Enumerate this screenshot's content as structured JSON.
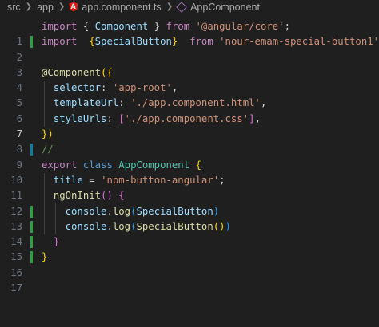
{
  "breadcrumb": {
    "items": [
      "src",
      "app",
      "app.component.ts",
      "AppComponent"
    ]
  },
  "colors": {
    "background": "#1f1f1f",
    "keyword": "#c586c0",
    "string": "#ce9178",
    "class": "#4ec9b0",
    "gutter_added": "#2ea043",
    "gutter_modified": "#0c7d9d"
  },
  "icons": {
    "file_icon": "angular-icon",
    "symbol_icon": "class-symbol-icon"
  },
  "editor": {
    "active_line": 7,
    "lines": [
      {
        "number": "1",
        "gutter": "none"
      },
      {
        "number": "2",
        "gutter": "added"
      },
      {
        "number": "3",
        "gutter": "none"
      },
      {
        "number": "4",
        "gutter": "none"
      },
      {
        "number": "5",
        "gutter": "none"
      },
      {
        "number": "6",
        "gutter": "none"
      },
      {
        "number": "7",
        "gutter": "none"
      },
      {
        "number": "8",
        "gutter": "none"
      },
      {
        "number": "9",
        "gutter": "modified"
      },
      {
        "number": "10",
        "gutter": "none"
      },
      {
        "number": "11",
        "gutter": "none"
      },
      {
        "number": "12",
        "gutter": "none"
      },
      {
        "number": "13",
        "gutter": "added"
      },
      {
        "number": "14",
        "gutter": "added"
      },
      {
        "number": "15",
        "gutter": "added"
      },
      {
        "number": "16",
        "gutter": "added"
      },
      {
        "number": "17",
        "gutter": "none"
      }
    ],
    "code": {
      "l1": {
        "import": "import",
        "ob": "{ ",
        "name": "Component",
        "cb": " }",
        "from": "from",
        "src": "'@angular/core'",
        "semi": ";"
      },
      "l2": {
        "import": "import",
        "ob": "{",
        "name": "SpecialButton",
        "cb": "}",
        "from": "from",
        "src": "'nour-emam-special-button1'",
        "semi": ";"
      },
      "l4": {
        "at": "@",
        "dec": "Component",
        "open": "({"
      },
      "l5": {
        "key": "selector",
        "colon": ": ",
        "val": "'app-root'",
        "comma": ","
      },
      "l6": {
        "key": "templateUrl",
        "colon": ": ",
        "val": "'./app.component.html'",
        "comma": ","
      },
      "l7": {
        "key": "styleUrls",
        "colon": ": ",
        "ob": "[",
        "val": "'./app.component.css'",
        "cb": "]",
        "comma": ","
      },
      "l8": {
        "close": "})"
      },
      "l9": {
        "comment": "//"
      },
      "l10": {
        "export": "export",
        "class": "class",
        "name": "AppComponent",
        "ob": "{"
      },
      "l11": {
        "key": "title",
        "eq": " = ",
        "val": "'npm-button-angular'",
        "semi": ";"
      },
      "l12": {
        "fn": "ngOnInit",
        "parens": "()",
        "ob": "{"
      },
      "l13": {
        "obj": "console",
        "dot": ".",
        "fn": "log",
        "op": "(",
        "arg": "SpecialButton",
        "cp": ")"
      },
      "l14": {
        "obj": "console",
        "dot": ".",
        "fn": "log",
        "op": "(",
        "arg": "SpecialButton",
        "call": "()",
        "cp": ")"
      },
      "l15": {
        "cb": "}"
      },
      "l16": {
        "cb": "}"
      }
    }
  }
}
